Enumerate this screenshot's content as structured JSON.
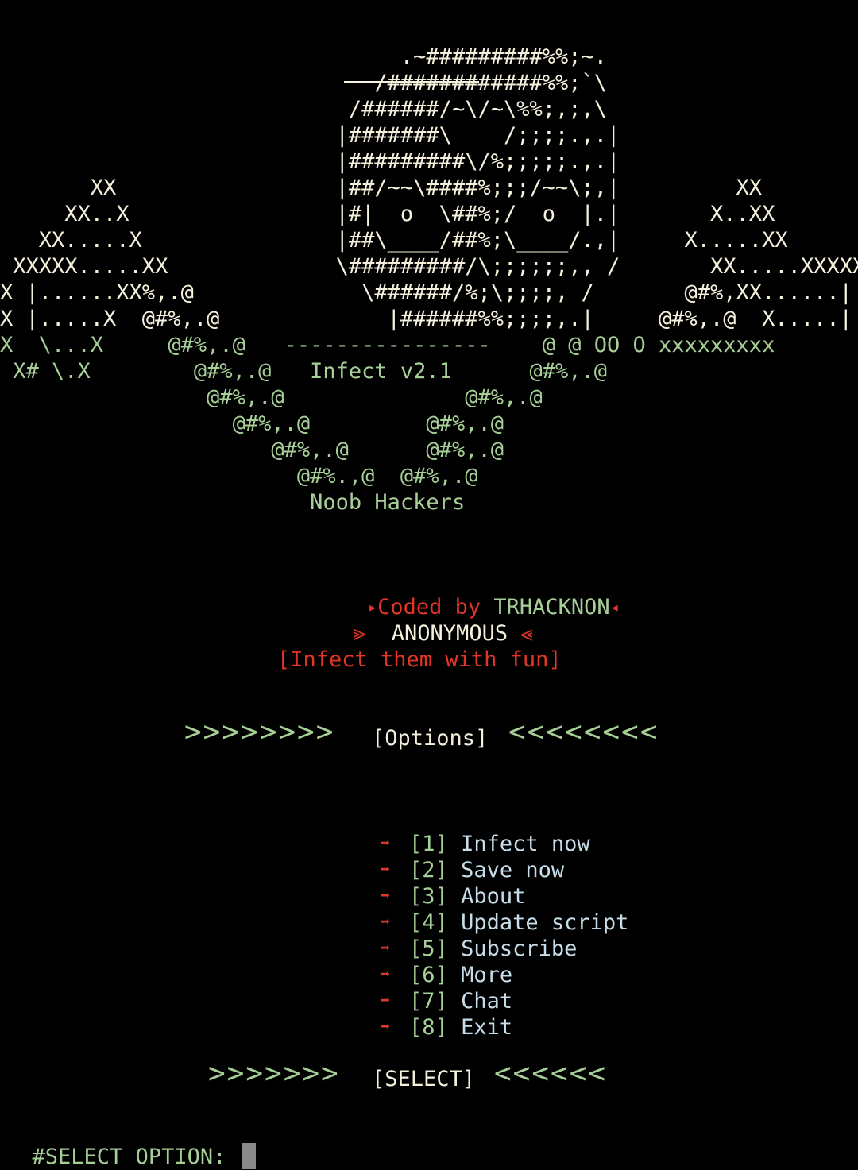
{
  "banner": {
    "art_lines": [
      "                               .~#########%%;~.",
      "                             /############%%;`\\",
      "                           /######/~\\/~\\%%;,;,\\",
      "                          |#######\\    /;;;;.,.|",
      "                          |#########\\/%;;;;;.,.|",
      "       XX                 |##/~~\\####%;;;/~~\\;,|         XX",
      "     XX..X                |#|  o  \\##%;/  o  |.|       X..XX",
      "   XX.....X               |##\\____/##%;\\____/.,|     X.....XX",
      " XXXXX.....XX             \\#########/\\;;;;;;,, /       XX.....XXXXX",
      "X |......XX%,.@             \\######/%;\\;;;;, /       @#%,XX......| X",
      "X |.....X  @#%,.@             |######%%;;;;,.|     @#%,.@  X.....| X"
    ],
    "green_lines": [
      "X  \\...X     @#%,.@   ----------------    @ @ OO O xxxxxxxxx",
      " X# \\.X        @#%,.@   Infect v2.1      @#%,.@",
      "                @#%,.@              @#%,.@",
      "                  @#%,.@         @#%,.@",
      "                     @#%,.@      @#%,.@",
      "                       @#%.,@  @#%,.@",
      "                        Noob Hackers"
    ]
  },
  "credits": {
    "coded_by_prefix": "Coded by ",
    "author": "TRHACKNON",
    "alias": "ANONYMOUS",
    "tagline": "[Infect them with fun]",
    "arrow_right": "▸",
    "arrow_left": "◂",
    "double_right": "⪢",
    "double_left": "⪡"
  },
  "options_header": {
    "left_chevrons": ">>>>>>>>",
    "label": "[Options]",
    "right_chevrons": "<<<<<<<<"
  },
  "menu": {
    "bullet": "➡",
    "items": [
      {
        "num": "[1]",
        "label": "Infect now"
      },
      {
        "num": "[2]",
        "label": "Save now"
      },
      {
        "num": "[3]",
        "label": "About"
      },
      {
        "num": "[4]",
        "label": "Update script"
      },
      {
        "num": "[5]",
        "label": "Subscribe"
      },
      {
        "num": "[6]",
        "label": "More"
      },
      {
        "num": "[7]",
        "label": "Chat"
      },
      {
        "num": "[8]",
        "label": "Exit"
      }
    ]
  },
  "select_header": {
    "left_chevrons": ">>>>>>>",
    "label": "[SELECT]",
    "right_chevrons": "<<<<<<"
  },
  "prompt": {
    "label": "#SELECT OPTION: "
  },
  "colors": {
    "background": "#000000",
    "art": "#f4f0dc",
    "green": "#a6cf97",
    "red": "#e23528",
    "menu_text": "#c7dde9"
  }
}
